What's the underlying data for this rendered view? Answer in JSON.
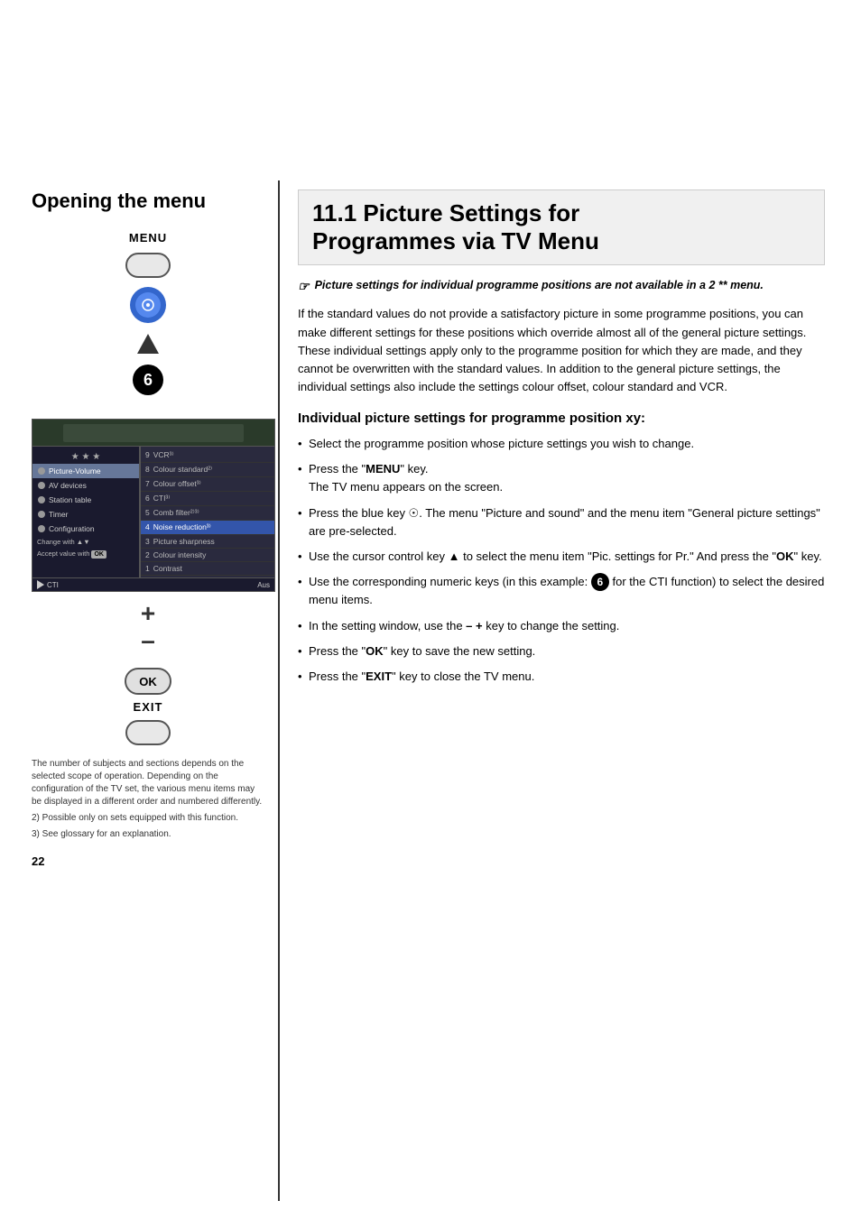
{
  "left": {
    "section_title": "Opening the menu",
    "menu_label": "MENU",
    "number_6": "6",
    "diagram_arrow": "▼",
    "plus_symbol": "+",
    "minus_symbol": "–",
    "ok_label": "OK",
    "exit_label": "EXIT",
    "footnote_main": "The number of subjects and sections depends on the selected scope of operation. Depending on the configuration of the TV set, the various menu items may be displayed in a different order and numbered differently.",
    "footnote_2": "2) Possible only on sets equipped with this function.",
    "footnote_3": "3) See glossary for an explanation.",
    "page_number": "22",
    "tv_menu": {
      "left_items": [
        {
          "label": "Picture-Volume",
          "selected": true
        },
        {
          "label": "AV devices",
          "selected": false
        },
        {
          "label": "Station table",
          "selected": false
        },
        {
          "label": "Timer",
          "selected": false
        },
        {
          "label": "Configuration",
          "selected": false
        }
      ],
      "change_label": "Change with",
      "accept_label": "Accept value with",
      "right_items": [
        {
          "number": "9",
          "label": "VCR³⁾",
          "highlighted": false
        },
        {
          "number": "8",
          "label": "Colour standard²⁾",
          "highlighted": false
        },
        {
          "number": "7",
          "label": "Colour offset³⁾",
          "highlighted": false
        },
        {
          "number": "6",
          "label": "CTI³⁾",
          "highlighted": false
        },
        {
          "number": "5",
          "label": "Comb filter²⁾³⁾",
          "highlighted": false
        },
        {
          "number": "4",
          "label": "Noise reduction³⁾",
          "highlighted": true
        },
        {
          "number": "3",
          "label": "Picture sharpness",
          "highlighted": false
        },
        {
          "number": "2",
          "label": "Colour intensity",
          "highlighted": false
        },
        {
          "number": "1",
          "label": "Contrast",
          "highlighted": false
        }
      ],
      "footer_left": "▶ CTI",
      "footer_right": "Aus"
    }
  },
  "right": {
    "section_title_line1": "11.1 Picture Settings for",
    "section_title_line2": "Programmes via TV Menu",
    "note_italic": "Picture settings for individual programme positions are not available in a 2 ** menu.",
    "body_text": "If the standard values do not provide a satisfactory picture in some programme positions, you can make different settings for these positions which override almost all of the general picture settings. These individual settings apply only to the programme position for which they are made, and they cannot be overwritten with the standard values. In addition to the general picture settings, the individual settings also include the settings colour offset, colour standard and VCR.",
    "subsection_title": "Individual picture settings for programme position xy:",
    "bullets": [
      "Select the programme position whose picture settings you wish to change.",
      "Press the \"MENU\" key. The TV menu appears on the screen.",
      "Press the blue key ☉. The menu \"Picture and sound\" and the menu item \"General picture settings\" are pre-selected.",
      "Use the cursor control key ▲ to select the menu item \"Pic. settings for Pr.\" And press the \"OK\" key.",
      "Use the corresponding numeric keys (in this example: ⑥ for the CTI function) to select the desired menu items.",
      "In the setting window, use the – + key to change the setting.",
      "Press the \"OK\" key to save the new setting.",
      "Press the \"EXIT\" key to close the TV menu."
    ]
  }
}
